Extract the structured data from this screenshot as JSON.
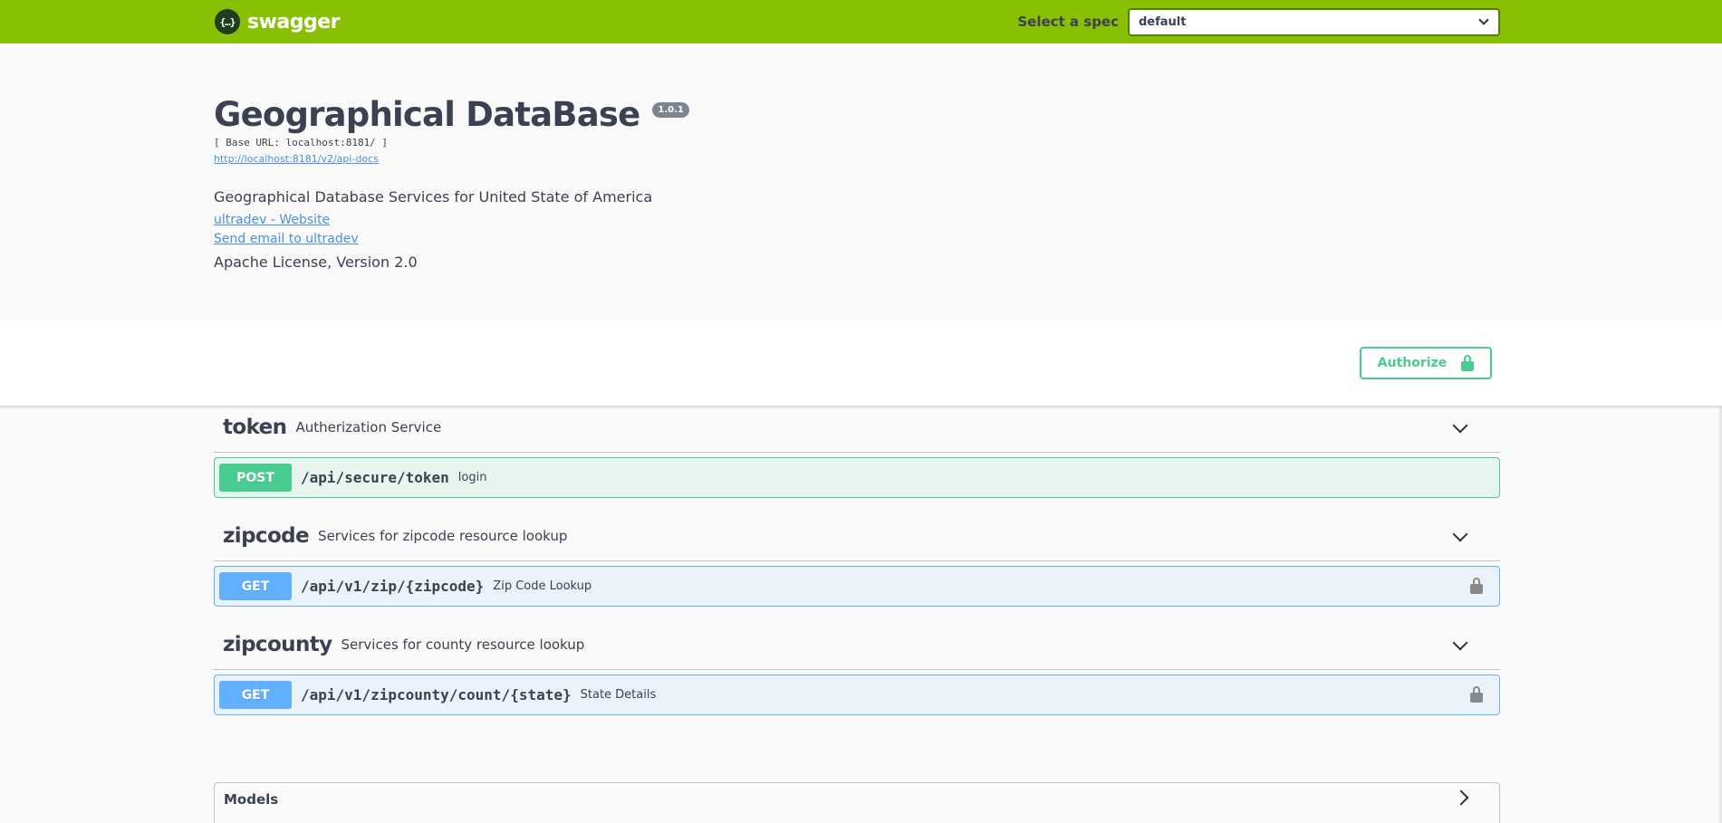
{
  "topbar": {
    "logo_symbol": "{…}",
    "logo_text": "swagger",
    "spec_label": "Select a spec",
    "spec_value": "default"
  },
  "info": {
    "title": "Geographical DataBase",
    "version": "1.0.1",
    "base_url": "[ Base URL: localhost:8181/ ]",
    "api_docs_link": "http://localhost:8181/v2/api-docs",
    "description": "Geographical Database Services for United State of America",
    "contact_website": "ultradev - Website",
    "contact_email": "Send email to ultradev",
    "license": "Apache License, Version 2.0"
  },
  "authorize": {
    "label": "Authorize"
  },
  "tags": [
    {
      "name": "token",
      "description": "Autherization Service",
      "operation": {
        "method": "POST",
        "path": "/api/secure/token",
        "summary": "login",
        "locked": false
      }
    },
    {
      "name": "zipcode",
      "description": "Services for zipcode resource lookup",
      "operation": {
        "method": "GET",
        "path": "/api/v1/zip/{zipcode}",
        "summary": "Zip Code Lookup",
        "locked": true
      }
    },
    {
      "name": "zipcounty",
      "description": "Services for county resource lookup",
      "operation": {
        "method": "GET",
        "path": "/api/v1/zipcounty/count/{state}",
        "summary": "State Details",
        "locked": true
      }
    }
  ],
  "models": {
    "title": "Models"
  },
  "colors": {
    "topbar": "#89bf04",
    "post": "#49cc90",
    "get": "#61affe",
    "link": "#4990e2",
    "text": "#3b4151"
  }
}
